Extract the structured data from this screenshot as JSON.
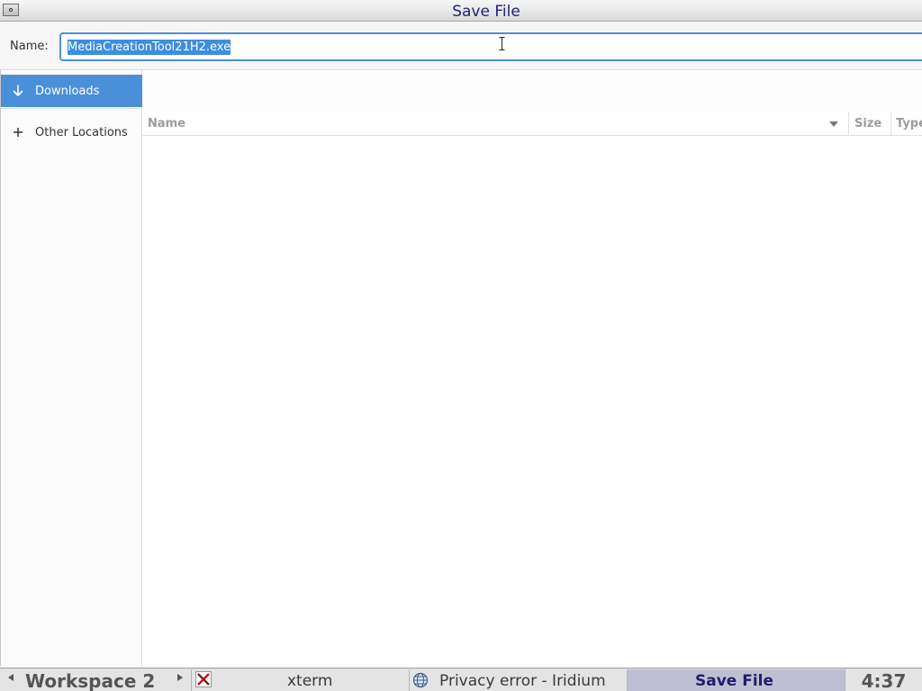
{
  "window": {
    "title": "Save File"
  },
  "name_field": {
    "label": "Name:",
    "value": "MediaCreationTool21H2.exe"
  },
  "sidebar": {
    "items": [
      {
        "label": "Downloads",
        "icon": "arrow-down-icon",
        "selected": true
      },
      {
        "label": "Other Locations",
        "icon": "plus-icon",
        "selected": false
      }
    ]
  },
  "file_list": {
    "columns": [
      {
        "label": "Name",
        "sort": "descending"
      },
      {
        "label": "Size"
      },
      {
        "label": "Type"
      }
    ],
    "rows": []
  },
  "taskbar": {
    "workspace": "Workspace 2",
    "tasks": [
      {
        "label": "xterm",
        "icon": "x-terminal-icon",
        "active": false
      },
      {
        "label": "Privacy error - Iridium",
        "icon": "globe-icon",
        "active": false
      },
      {
        "label": "Save File",
        "icon": "",
        "active": true
      }
    ],
    "clock": "4:37"
  },
  "colors": {
    "accent": "#4a90d9",
    "selection": "#3d8ee0",
    "title_text": "#1f1f7a",
    "active_task": "#bfbfd3"
  }
}
